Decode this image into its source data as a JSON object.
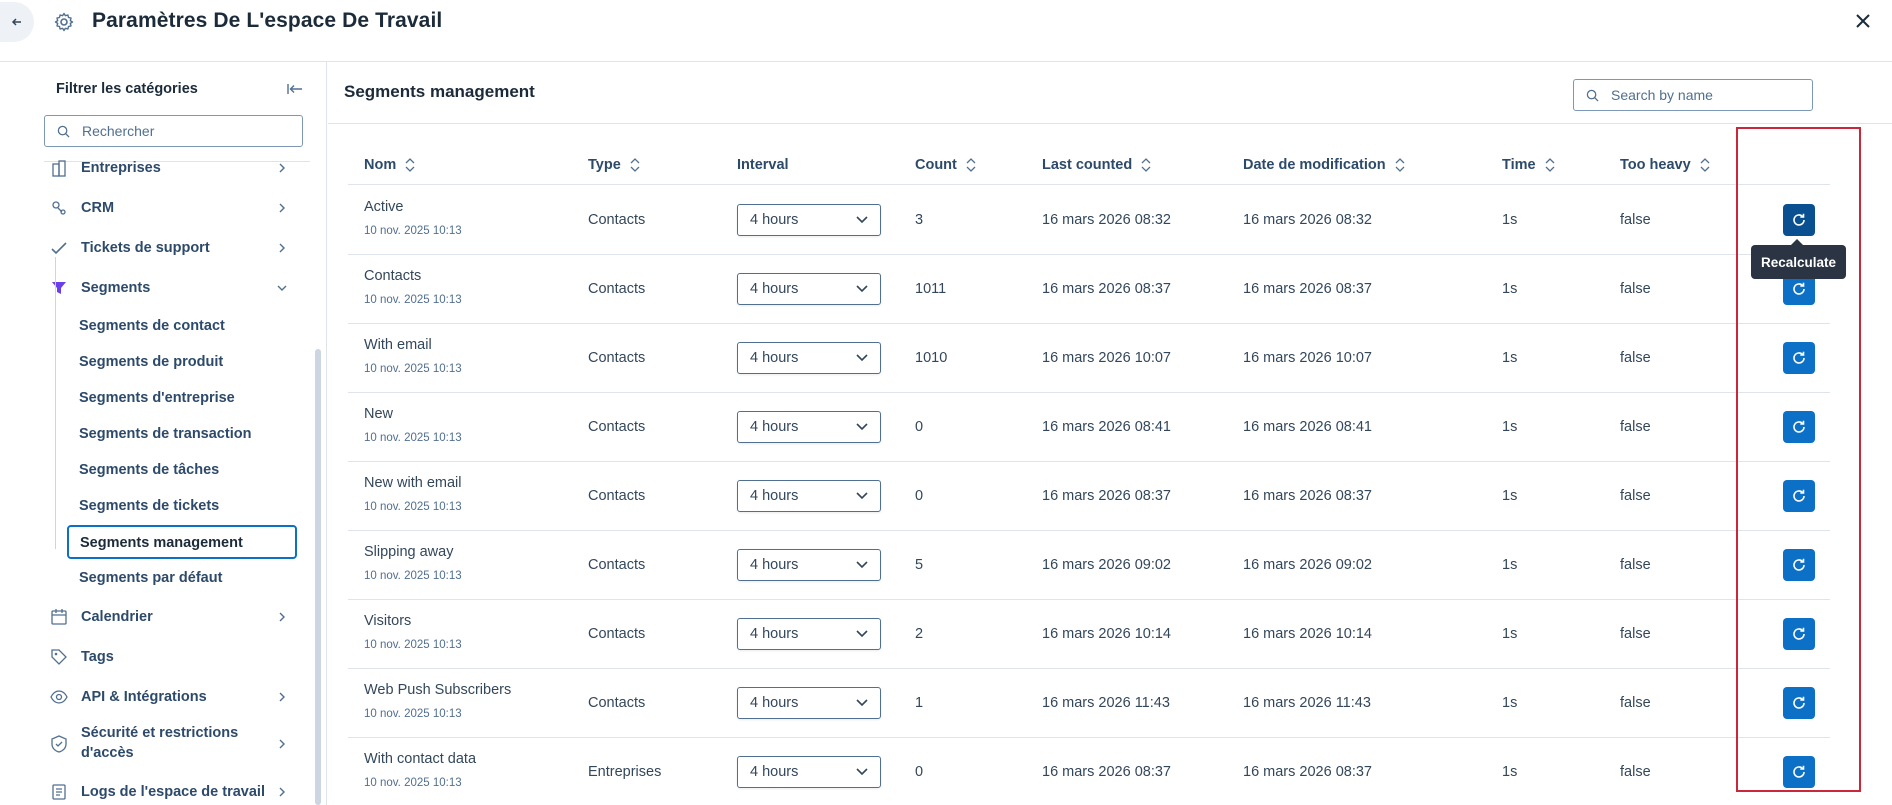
{
  "header": {
    "title": "Paramètres De L'espace De Travail",
    "back_icon": "arrow-left-icon",
    "settings_icon": "gear-icon",
    "close_icon": "close-icon"
  },
  "sidebar": {
    "filter_title": "Filtrer les catégories",
    "search_placeholder": "Rechercher",
    "items": [
      {
        "label": "Entreprises",
        "icon": "building-icon"
      },
      {
        "label": "CRM",
        "icon": "crm-icon"
      },
      {
        "label": "Tickets de support",
        "icon": "ticket-check-icon"
      },
      {
        "label": "Segments",
        "icon": "funnel-icon",
        "expanded": true
      },
      {
        "label": "Calendrier",
        "icon": "calendar-icon"
      },
      {
        "label": "Tags",
        "icon": "tag-icon"
      },
      {
        "label": "API & Intégrations",
        "icon": "eye-api-icon"
      },
      {
        "label": "Sécurité et restrictions d'accès",
        "line1": "Sécurité et restrictions",
        "line2": "d'accès",
        "icon": "shield-icon"
      },
      {
        "label": "Logs de l'espace de travail",
        "icon": "log-icon"
      }
    ],
    "segments_children": [
      "Segments de contact",
      "Segments de produit",
      "Segments d'entreprise",
      "Segments de transaction",
      "Segments de tâches",
      "Segments de tickets",
      "Segments management",
      "Segments par défaut"
    ],
    "active_child": "Segments management"
  },
  "main": {
    "title": "Segments management",
    "search_placeholder": "Search by name",
    "columns": [
      "Nom",
      "Type",
      "Interval",
      "Count",
      "Last counted",
      "Date de modification",
      "Time",
      "Too heavy"
    ],
    "tooltip": "Recalculate",
    "rows": [
      {
        "name": "Active",
        "created": "10 nov. 2025 10:13",
        "type": "Contacts",
        "interval": "4 hours",
        "count": "3",
        "last_counted": "16 mars 2026 08:32",
        "modified": "16 mars 2026 08:32",
        "time": "1s",
        "too_heavy": "false"
      },
      {
        "name": "Contacts",
        "created": "10 nov. 2025 10:13",
        "type": "Contacts",
        "interval": "4 hours",
        "count": "1011",
        "last_counted": "16 mars 2026 08:37",
        "modified": "16 mars 2026 08:37",
        "time": "1s",
        "too_heavy": "false"
      },
      {
        "name": "With email",
        "created": "10 nov. 2025 10:13",
        "type": "Contacts",
        "interval": "4 hours",
        "count": "1010",
        "last_counted": "16 mars 2026 10:07",
        "modified": "16 mars 2026 10:07",
        "time": "1s",
        "too_heavy": "false"
      },
      {
        "name": "New",
        "created": "10 nov. 2025 10:13",
        "type": "Contacts",
        "interval": "4 hours",
        "count": "0",
        "last_counted": "16 mars 2026 08:41",
        "modified": "16 mars 2026 08:41",
        "time": "1s",
        "too_heavy": "false"
      },
      {
        "name": "New with email",
        "created": "10 nov. 2025 10:13",
        "type": "Contacts",
        "interval": "4 hours",
        "count": "0",
        "last_counted": "16 mars 2026 08:37",
        "modified": "16 mars 2026 08:37",
        "time": "1s",
        "too_heavy": "false"
      },
      {
        "name": "Slipping away",
        "created": "10 nov. 2025 10:13",
        "type": "Contacts",
        "interval": "4 hours",
        "count": "5",
        "last_counted": "16 mars 2026 09:02",
        "modified": "16 mars 2026 09:02",
        "time": "1s",
        "too_heavy": "false"
      },
      {
        "name": "Visitors",
        "created": "10 nov. 2025 10:13",
        "type": "Contacts",
        "interval": "4 hours",
        "count": "2",
        "last_counted": "16 mars 2026 10:14",
        "modified": "16 mars 2026 10:14",
        "time": "1s",
        "too_heavy": "false"
      },
      {
        "name": "Web Push Subscribers",
        "created": "10 nov. 2025 10:13",
        "type": "Contacts",
        "interval": "4 hours",
        "count": "1",
        "last_counted": "16 mars 2026 11:43",
        "modified": "16 mars 2026 11:43",
        "time": "1s",
        "too_heavy": "false"
      },
      {
        "name": "With contact data",
        "created": "10 nov. 2025 10:13",
        "type": "Entreprises",
        "interval": "4 hours",
        "count": "0",
        "last_counted": "16 mars 2026 08:37",
        "modified": "16 mars 2026 08:37",
        "time": "1s",
        "too_heavy": "false"
      }
    ]
  },
  "colors": {
    "accent": "#0b70c6",
    "highlight": "#c8283a",
    "text": "#33475b"
  }
}
